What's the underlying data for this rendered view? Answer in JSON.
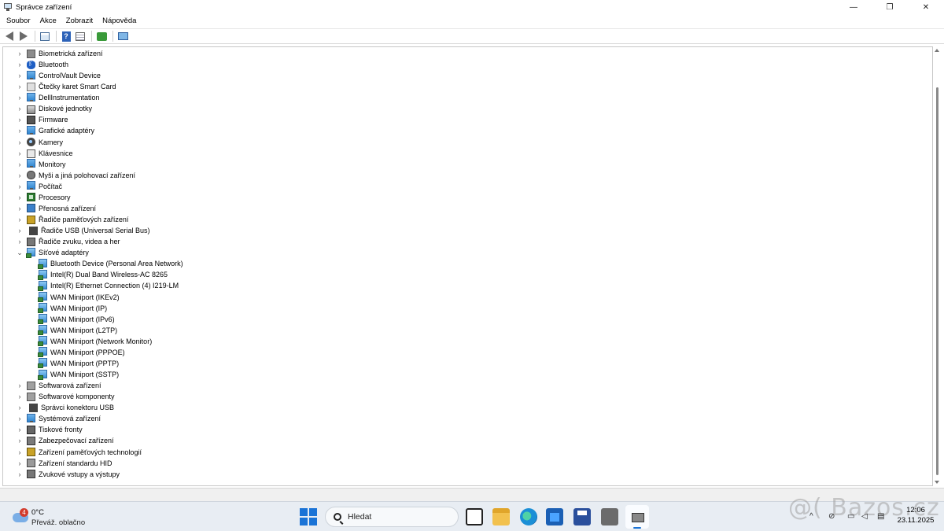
{
  "window": {
    "title": "Správce zařízení",
    "controls": {
      "minimize": "—",
      "maximize": "❐",
      "close": "✕"
    }
  },
  "menu": [
    "Soubor",
    "Akce",
    "Zobrazit",
    "Nápověda"
  ],
  "toolbar": {
    "icons": [
      "back-arrow-icon",
      "forward-arrow-icon",
      "device-list-icon",
      "help-icon",
      "properties-icon",
      "scan-hardware-icon",
      "monitor-icon"
    ]
  },
  "tree": {
    "categories": [
      {
        "label": "Biometrická zařízení",
        "icon": "ic-gray"
      },
      {
        "label": "Bluetooth",
        "icon": "ic-bluetooth"
      },
      {
        "label": "ControlVault Device",
        "icon": "ic-monitor"
      },
      {
        "label": "Čtečky karet Smart Card",
        "icon": "ic-smartcard"
      },
      {
        "label": "DellInstrumentation",
        "icon": "ic-monitor"
      },
      {
        "label": "Diskové jednotky",
        "icon": "ic-disk"
      },
      {
        "label": "Firmware",
        "icon": "ic-fw"
      },
      {
        "label": "Grafické adaptéry",
        "icon": "ic-monitor"
      },
      {
        "label": "Kamery",
        "icon": "ic-cam"
      },
      {
        "label": "Klávesnice",
        "icon": "ic-kbd"
      },
      {
        "label": "Monitory",
        "icon": "ic-monitor"
      },
      {
        "label": "Myši a jiná polohovací zařízení",
        "icon": "ic-mouse"
      },
      {
        "label": "Počítač",
        "icon": "ic-monitor"
      },
      {
        "label": "Procesory",
        "icon": "ic-cpu"
      },
      {
        "label": "Přenosná zařízení",
        "icon": "ic-mobile"
      },
      {
        "label": "Řadiče paměťových zařízení",
        "icon": "ic-storage"
      },
      {
        "label": "Řadiče USB (Universal Serial Bus)",
        "icon": "ic-usb"
      },
      {
        "label": "Řadiče zvuku, videa a her",
        "icon": "ic-speaker"
      },
      {
        "label": "Síťové adaptéry",
        "icon": "ic-net",
        "expanded": true,
        "children": [
          "Bluetooth Device (Personal Area Network)",
          "Intel(R) Dual Band Wireless-AC 8265",
          "Intel(R) Ethernet Connection (4) I219-LM",
          "WAN Miniport (IKEv2)",
          "WAN Miniport (IP)",
          "WAN Miniport (IPv6)",
          "WAN Miniport (L2TP)",
          "WAN Miniport (Network Monitor)",
          "WAN Miniport (PPPOE)",
          "WAN Miniport (PPTP)",
          "WAN Miniport (SSTP)"
        ]
      },
      {
        "label": "Softwarová zařízení",
        "icon": "ic-sw"
      },
      {
        "label": "Softwarové komponenty",
        "icon": "ic-sw"
      },
      {
        "label": "Správci konektoru USB",
        "icon": "ic-usb"
      },
      {
        "label": "Systémová zařízení",
        "icon": "ic-monitor"
      },
      {
        "label": "Tiskové fronty",
        "icon": "ic-printer"
      },
      {
        "label": "Zabezpečovací zařízení",
        "icon": "ic-security"
      },
      {
        "label": "Zařízení paměťových technologií",
        "icon": "ic-storage"
      },
      {
        "label": "Zařízení standardu HID",
        "icon": "ic-hid"
      },
      {
        "label": "Zvukové vstupy a výstupy",
        "icon": "ic-speaker"
      }
    ]
  },
  "taskbar": {
    "weather": {
      "badge": "4",
      "temp": "0°C",
      "condition": "Převáž. oblačno"
    },
    "search_label": "Hledat",
    "watermark": "@( Bazos.cz",
    "clock": {
      "time": "12:06",
      "date": "23.11.2025"
    },
    "tray": {
      "chevron": "^"
    }
  },
  "colors": {
    "accent": "#1a73d6",
    "taskbar_bg": "#e8edf3"
  }
}
